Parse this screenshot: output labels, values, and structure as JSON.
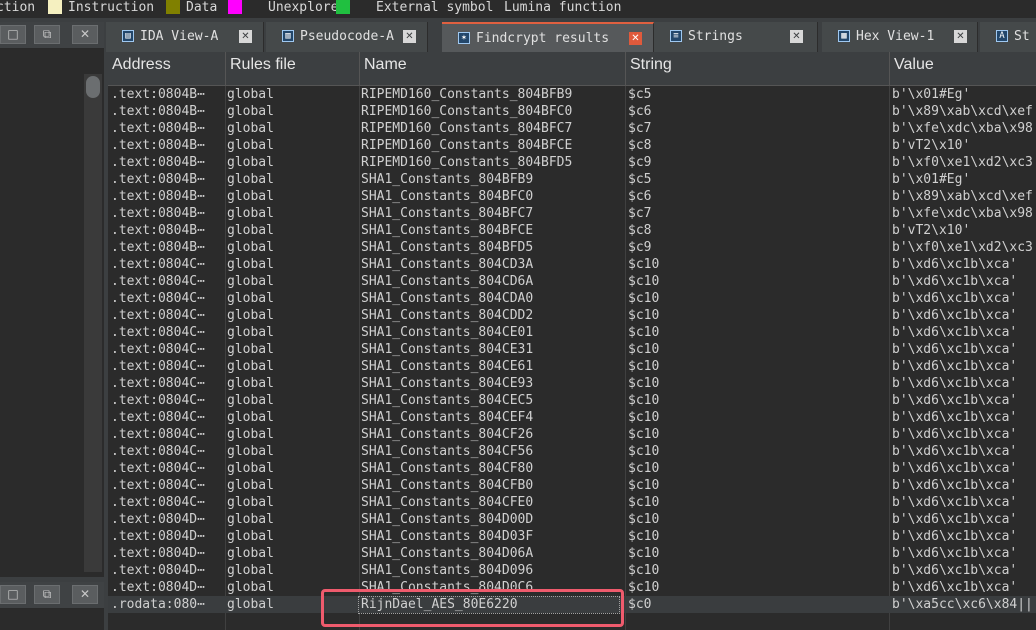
{
  "legend": [
    {
      "label": "ction",
      "color": "#8b0000"
    },
    {
      "label": "Instruction",
      "color": "#f5f0c0"
    },
    {
      "label": "Data",
      "color": "#808000"
    },
    {
      "label": "Unexplored",
      "color": "#ff00ff"
    },
    {
      "label": "External symbol",
      "color": "#20c040"
    },
    {
      "label": "Lumina function",
      "color": ""
    }
  ],
  "tabs": [
    {
      "label": "IDA View-A",
      "icon": "ida-view-icon"
    },
    {
      "label": "Pseudocode-A",
      "icon": "pseudocode-icon"
    },
    {
      "label": "Findcrypt results",
      "icon": "findcrypt-icon",
      "active": true
    },
    {
      "label": "Strings",
      "icon": "strings-icon"
    },
    {
      "label": "Hex View-1",
      "icon": "hex-view-icon"
    },
    {
      "label": "St",
      "icon": "structures-icon"
    }
  ],
  "columns": [
    "Address",
    "Rules file",
    "Name",
    "String",
    "Value"
  ],
  "rows": [
    {
      "address": ".text:0804B⋯",
      "rules": "global",
      "name": "RIPEMD160_Constants_804BFB9",
      "string": "$c5",
      "value": "b'\\x01#Eg'"
    },
    {
      "address": ".text:0804B⋯",
      "rules": "global",
      "name": "RIPEMD160_Constants_804BFC0",
      "string": "$c6",
      "value": "b'\\x89\\xab\\xcd\\xef"
    },
    {
      "address": ".text:0804B⋯",
      "rules": "global",
      "name": "RIPEMD160_Constants_804BFC7",
      "string": "$c7",
      "value": "b'\\xfe\\xdc\\xba\\x98"
    },
    {
      "address": ".text:0804B⋯",
      "rules": "global",
      "name": "RIPEMD160_Constants_804BFCE",
      "string": "$c8",
      "value": "b'vT2\\x10'"
    },
    {
      "address": ".text:0804B⋯",
      "rules": "global",
      "name": "RIPEMD160_Constants_804BFD5",
      "string": "$c9",
      "value": "b'\\xf0\\xe1\\xd2\\xc3"
    },
    {
      "address": ".text:0804B⋯",
      "rules": "global",
      "name": "SHA1_Constants_804BFB9",
      "string": "$c5",
      "value": "b'\\x01#Eg'"
    },
    {
      "address": ".text:0804B⋯",
      "rules": "global",
      "name": "SHA1_Constants_804BFC0",
      "string": "$c6",
      "value": "b'\\x89\\xab\\xcd\\xef"
    },
    {
      "address": ".text:0804B⋯",
      "rules": "global",
      "name": "SHA1_Constants_804BFC7",
      "string": "$c7",
      "value": "b'\\xfe\\xdc\\xba\\x98"
    },
    {
      "address": ".text:0804B⋯",
      "rules": "global",
      "name": "SHA1_Constants_804BFCE",
      "string": "$c8",
      "value": "b'vT2\\x10'"
    },
    {
      "address": ".text:0804B⋯",
      "rules": "global",
      "name": "SHA1_Constants_804BFD5",
      "string": "$c9",
      "value": "b'\\xf0\\xe1\\xd2\\xc3"
    },
    {
      "address": ".text:0804C⋯",
      "rules": "global",
      "name": "SHA1_Constants_804CD3A",
      "string": "$c10",
      "value": "b'\\xd6\\xc1b\\xca'"
    },
    {
      "address": ".text:0804C⋯",
      "rules": "global",
      "name": "SHA1_Constants_804CD6A",
      "string": "$c10",
      "value": "b'\\xd6\\xc1b\\xca'"
    },
    {
      "address": ".text:0804C⋯",
      "rules": "global",
      "name": "SHA1_Constants_804CDA0",
      "string": "$c10",
      "value": "b'\\xd6\\xc1b\\xca'"
    },
    {
      "address": ".text:0804C⋯",
      "rules": "global",
      "name": "SHA1_Constants_804CDD2",
      "string": "$c10",
      "value": "b'\\xd6\\xc1b\\xca'"
    },
    {
      "address": ".text:0804C⋯",
      "rules": "global",
      "name": "SHA1_Constants_804CE01",
      "string": "$c10",
      "value": "b'\\xd6\\xc1b\\xca'"
    },
    {
      "address": ".text:0804C⋯",
      "rules": "global",
      "name": "SHA1_Constants_804CE31",
      "string": "$c10",
      "value": "b'\\xd6\\xc1b\\xca'"
    },
    {
      "address": ".text:0804C⋯",
      "rules": "global",
      "name": "SHA1_Constants_804CE61",
      "string": "$c10",
      "value": "b'\\xd6\\xc1b\\xca'"
    },
    {
      "address": ".text:0804C⋯",
      "rules": "global",
      "name": "SHA1_Constants_804CE93",
      "string": "$c10",
      "value": "b'\\xd6\\xc1b\\xca'"
    },
    {
      "address": ".text:0804C⋯",
      "rules": "global",
      "name": "SHA1_Constants_804CEC5",
      "string": "$c10",
      "value": "b'\\xd6\\xc1b\\xca'"
    },
    {
      "address": ".text:0804C⋯",
      "rules": "global",
      "name": "SHA1_Constants_804CEF4",
      "string": "$c10",
      "value": "b'\\xd6\\xc1b\\xca'"
    },
    {
      "address": ".text:0804C⋯",
      "rules": "global",
      "name": "SHA1_Constants_804CF26",
      "string": "$c10",
      "value": "b'\\xd6\\xc1b\\xca'"
    },
    {
      "address": ".text:0804C⋯",
      "rules": "global",
      "name": "SHA1_Constants_804CF56",
      "string": "$c10",
      "value": "b'\\xd6\\xc1b\\xca'"
    },
    {
      "address": ".text:0804C⋯",
      "rules": "global",
      "name": "SHA1_Constants_804CF80",
      "string": "$c10",
      "value": "b'\\xd6\\xc1b\\xca'"
    },
    {
      "address": ".text:0804C⋯",
      "rules": "global",
      "name": "SHA1_Constants_804CFB0",
      "string": "$c10",
      "value": "b'\\xd6\\xc1b\\xca'"
    },
    {
      "address": ".text:0804C⋯",
      "rules": "global",
      "name": "SHA1_Constants_804CFE0",
      "string": "$c10",
      "value": "b'\\xd6\\xc1b\\xca'"
    },
    {
      "address": ".text:0804D⋯",
      "rules": "global",
      "name": "SHA1_Constants_804D00D",
      "string": "$c10",
      "value": "b'\\xd6\\xc1b\\xca'"
    },
    {
      "address": ".text:0804D⋯",
      "rules": "global",
      "name": "SHA1_Constants_804D03F",
      "string": "$c10",
      "value": "b'\\xd6\\xc1b\\xca'"
    },
    {
      "address": ".text:0804D⋯",
      "rules": "global",
      "name": "SHA1_Constants_804D06A",
      "string": "$c10",
      "value": "b'\\xd6\\xc1b\\xca'"
    },
    {
      "address": ".text:0804D⋯",
      "rules": "global",
      "name": "SHA1_Constants_804D096",
      "string": "$c10",
      "value": "b'\\xd6\\xc1b\\xca'"
    },
    {
      "address": ".text:0804D⋯",
      "rules": "global",
      "name": "SHA1_Constants_804D0C6",
      "string": "$c10",
      "value": "b'\\xd6\\xc1b\\xca'"
    },
    {
      "address": ".rodata:080⋯",
      "rules": "global",
      "name": "RijnDael_AES_80E6220",
      "string": "$c0",
      "value": "b'\\xa5cc\\xc6\\x84||"
    }
  ]
}
